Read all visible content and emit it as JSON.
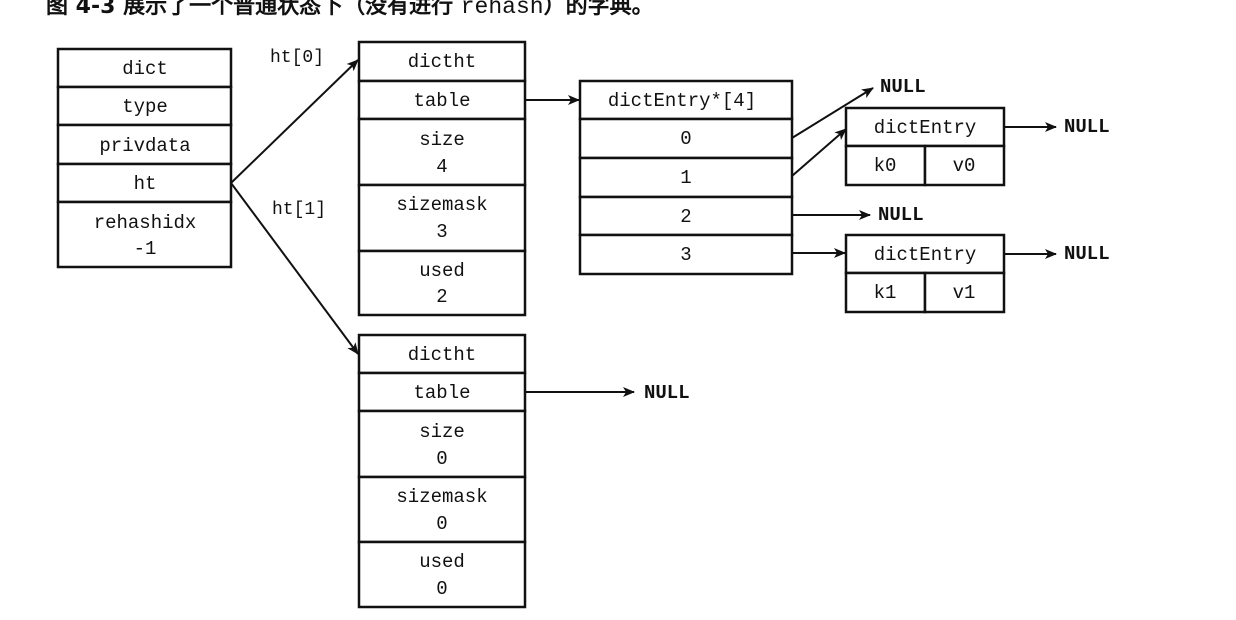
{
  "title": {
    "prefix": "图 4-3 展示了一个普通状态下（没有进行 ",
    "code": "rehash",
    "suffix": "）的字典。"
  },
  "dict": {
    "header": "dict",
    "fields": [
      {
        "name": "type"
      },
      {
        "name": "privdata"
      },
      {
        "name": "ht"
      },
      {
        "name": "rehashidx",
        "value": "-1"
      }
    ]
  },
  "links": {
    "ht0_label": "ht[0]",
    "ht1_label": "ht[1]",
    "null": "NULL"
  },
  "ht0": {
    "header": "dictht",
    "fields": [
      {
        "name": "table"
      },
      {
        "name": "size",
        "value": "4"
      },
      {
        "name": "sizemask",
        "value": "3"
      },
      {
        "name": "used",
        "value": "2"
      }
    ]
  },
  "ht1": {
    "header": "dictht",
    "fields": [
      {
        "name": "table"
      },
      {
        "name": "size",
        "value": "0"
      },
      {
        "name": "sizemask",
        "value": "0"
      },
      {
        "name": "used",
        "value": "0"
      }
    ]
  },
  "table": {
    "header": "dictEntry*[4]",
    "slots": [
      "0",
      "1",
      "2",
      "3"
    ]
  },
  "entries": [
    {
      "header": "dictEntry",
      "key": "k0",
      "value": "v0"
    },
    {
      "header": "dictEntry",
      "key": "k1",
      "value": "v1"
    }
  ]
}
